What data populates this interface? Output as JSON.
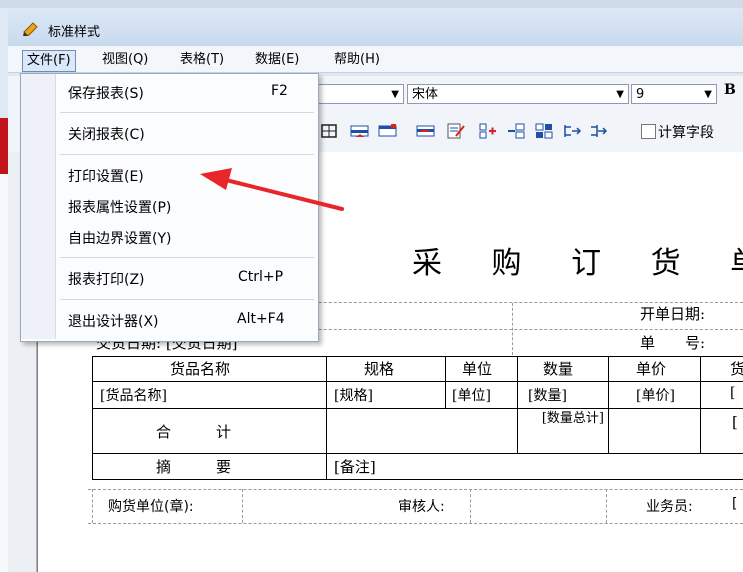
{
  "window": {
    "title": "标准样式"
  },
  "menubar": {
    "file": "文件(F)",
    "view": "视图(Q)",
    "table": "表格(T)",
    "data": "数据(E)",
    "help": "帮助(H)"
  },
  "file_menu": {
    "items": [
      {
        "label": "保存报表(S)",
        "shortcut": "F2"
      },
      {
        "label": "关闭报表(C)",
        "shortcut": ""
      },
      {
        "label": "打印设置(E)",
        "shortcut": ""
      },
      {
        "label": "报表属性设置(P)",
        "shortcut": ""
      },
      {
        "label": "自由边界设置(Y)",
        "shortcut": ""
      },
      {
        "label": "报表打印(Z)",
        "shortcut": "Ctrl+P"
      },
      {
        "label": "退出设计器(X)",
        "shortcut": "Alt+F4"
      }
    ]
  },
  "toolbar": {
    "font_name": "宋体",
    "font_size": "9",
    "bold": "B",
    "calc_field_label": "计算字段"
  },
  "report": {
    "title": "采 购 订 货 单",
    "open_date_label": "开单日期:",
    "number_label": "单　　号:",
    "field_bracket_top": "]",
    "delivery_date": "交货日期:  [交货日期]",
    "headers": [
      "货品名称",
      "规格",
      "单位",
      "数量",
      "单价",
      "货"
    ],
    "row_fields": [
      "[货品名称]",
      "[规格]",
      "[单位]",
      "[数量]",
      "[单价]",
      "["
    ],
    "total_label": "合　　　计",
    "total_qty": "[数量总计]",
    "total_right": "[",
    "summary_label": "摘　　　要",
    "summary_field": "[备注]",
    "footer_buyer": "购货单位(章):",
    "footer_reviewer": "审核人:",
    "footer_salesman": "业务员:",
    "footer_bracket": "["
  },
  "colors": {
    "annotation_arrow": "#e8262a",
    "title_bar": "#c9d9ee"
  }
}
